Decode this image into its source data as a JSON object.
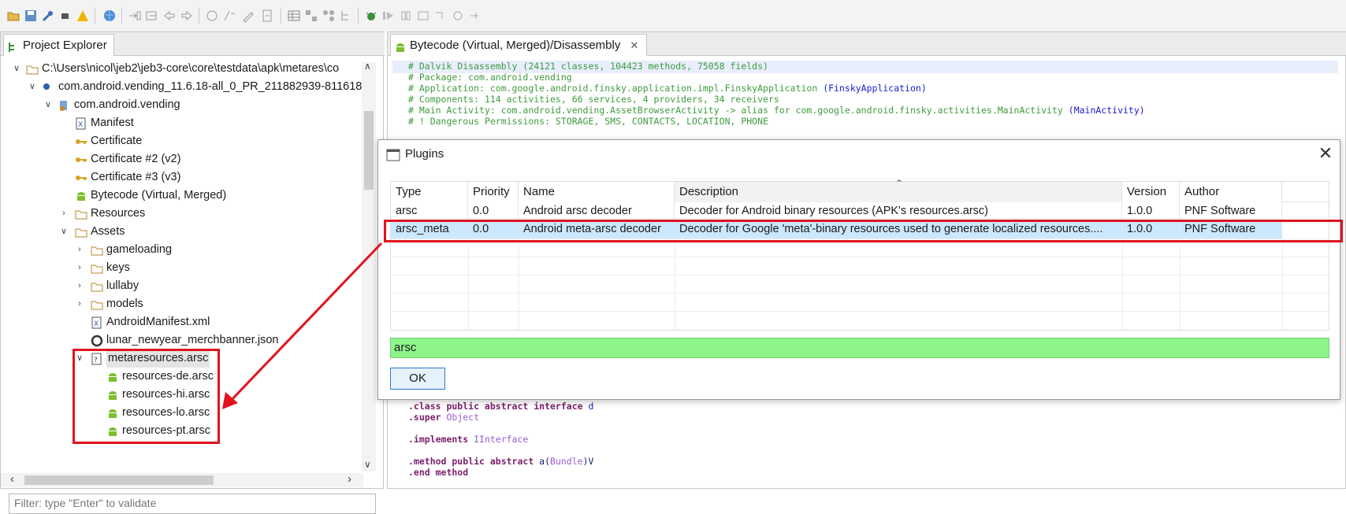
{
  "toolbar": {
    "icons": [
      "open-folder-icon",
      "save-icon",
      "wrench-icon",
      "stop-icon",
      "warning-icon",
      "globe-icon",
      "step-into-icon",
      "step-out-icon",
      "back-icon",
      "forward-icon",
      "comment-icon",
      "rename-icon",
      "edit-icon",
      "export-icon",
      "table-icon",
      "node-icon",
      "graph-icon",
      "tree-icon",
      "debug-icon",
      "run-icon",
      "pause-icon",
      "stop-icon",
      "step-icon",
      "loop-icon",
      "resume-icon"
    ]
  },
  "left_panel": {
    "tab_label": "Project Explorer",
    "tree": [
      {
        "label": "C:\\Users\\nicol\\jeb2\\jeb3-core\\core\\testdata\\apk\\metares\\co",
        "icon": "folder-icon"
      },
      {
        "label": "com.android.vending_11.6.18-all_0_PR_211882939-811618",
        "icon": "blue-dot-icon"
      },
      {
        "label": "com.android.vending",
        "icon": "package-icon"
      },
      {
        "label": "Manifest",
        "icon": "xml-file-icon"
      },
      {
        "label": "Certificate",
        "icon": "key-icon"
      },
      {
        "label": "Certificate #2 (v2)",
        "icon": "key-icon"
      },
      {
        "label": "Certificate #3 (v3)",
        "icon": "key-icon"
      },
      {
        "label": "Bytecode (Virtual, Merged)",
        "icon": "android-icon"
      },
      {
        "label": "Resources",
        "icon": "folder-icon"
      },
      {
        "label": "Assets",
        "icon": "folder-icon"
      },
      {
        "label": "gameloading",
        "icon": "folder-icon"
      },
      {
        "label": "keys",
        "icon": "folder-icon"
      },
      {
        "label": "lullaby",
        "icon": "folder-icon"
      },
      {
        "label": "models",
        "icon": "folder-icon"
      },
      {
        "label": "AndroidManifest.xml",
        "icon": "xml-file-icon"
      },
      {
        "label": "lunar_newyear_merchbanner.json",
        "icon": "json-icon"
      },
      {
        "label": "metaresources.arsc",
        "icon": "unknown-file-icon"
      },
      {
        "label": "resources-de.arsc",
        "icon": "android-icon"
      },
      {
        "label": "resources-hi.arsc",
        "icon": "android-icon"
      },
      {
        "label": "resources-lo.arsc",
        "icon": "android-icon"
      },
      {
        "label": "resources-pt.arsc",
        "icon": "android-icon"
      }
    ],
    "filter_placeholder": "Filter: type \"Enter\" to validate"
  },
  "right_panel": {
    "tab_label": "Bytecode (Virtual, Merged)/Disassembly",
    "header_lines": [
      "# Dalvik Disassembly (24121 classes, 104423 methods, 75058 fields)",
      "# Package: com.android.vending",
      "# Application: com.google.android.finsky.application.impl.FinskyApplication ",
      "# Components: 114 activities, 66 services, 4 providers, 34 receivers",
      "# Main Activity: com.android.vending.AssetBrowserActivity -> alias for com.google.android.finsky.activities.MainActivity ",
      "# ! Dangerous Permissions: STORAGE, SMS, CONTACTS, LOCATION, PHONE"
    ],
    "app_link": "(FinskyApplication)",
    "activity_link": "(MainActivity)",
    "code": {
      "class_kw": ".class public abstract interface",
      "class_name": " d",
      "super_kw": ".super",
      "super_name": " Object",
      "implements_kw": ".implements",
      "implements_name": " IInterface",
      "method_kw": ".method public abstract",
      "method_sig_a": " a(",
      "method_sig_type": "Bundle",
      "method_sig_b": ")V",
      "end_method": ".end method"
    }
  },
  "dialog": {
    "title": "Plugins",
    "columns": [
      "Type",
      "Priority",
      "Name",
      "Description",
      "Version",
      "Author"
    ],
    "rows": [
      {
        "type": "arsc",
        "priority": "0.0",
        "name": "Android arsc decoder",
        "description": "Decoder for Android binary resources (APK's resources.arsc)",
        "version": "1.0.0",
        "author": "PNF Software"
      },
      {
        "type": "arsc_meta",
        "priority": "0.0",
        "name": "Android meta-arsc decoder",
        "description": "Decoder for Google 'meta'-binary resources used to generate localized resources....",
        "version": "1.0.0",
        "author": "PNF Software"
      }
    ],
    "search_value": "arsc",
    "ok_label": "OK"
  },
  "colors": {
    "highlight_red": "#e0141e",
    "selected_row": "#cce8ff",
    "search_bg": "#8df58a"
  }
}
